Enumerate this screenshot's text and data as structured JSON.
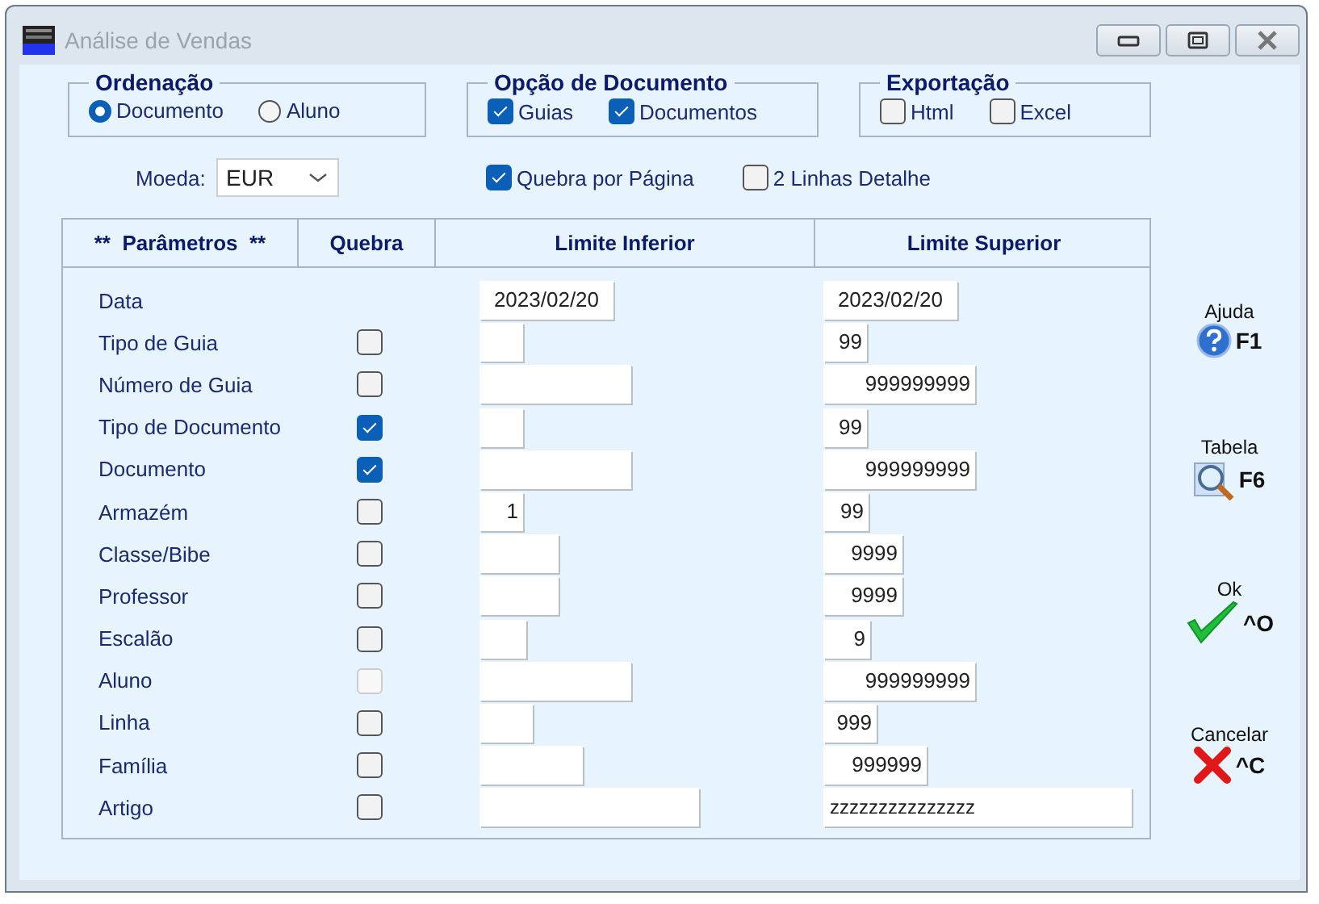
{
  "window": {
    "title": "Análise de Vendas"
  },
  "ordenacao": {
    "title": "Ordenação",
    "options": [
      {
        "label": "Documento",
        "selected": true
      },
      {
        "label": "Aluno",
        "selected": false
      }
    ]
  },
  "opcao_documento": {
    "title": "Opção de Documento",
    "options": [
      {
        "label": "Guias",
        "checked": true
      },
      {
        "label": "Documentos",
        "checked": true
      }
    ]
  },
  "exportacao": {
    "title": "Exportação",
    "options": [
      {
        "label": "Html",
        "checked": false
      },
      {
        "label": "Excel",
        "checked": false
      }
    ]
  },
  "moeda": {
    "label": "Moeda:",
    "value": "EUR"
  },
  "options": [
    {
      "label": "Quebra por Página",
      "checked": true
    },
    {
      "label": "2 Linhas Detalhe",
      "checked": false
    }
  ],
  "table": {
    "columns": [
      "**  Parâmetros  **",
      "Quebra",
      "Limite Inferior",
      "Limite Superior"
    ],
    "rows": [
      {
        "label": "Data",
        "inferior": "2023/02/20",
        "superior": "2023/02/20"
      },
      {
        "label": "Tipo de Guia",
        "quebra": {
          "checked": false,
          "disabled": false
        },
        "superior": "99"
      },
      {
        "label": "Número de Guia",
        "quebra": {
          "checked": false,
          "disabled": false
        },
        "superior": "999999999"
      },
      {
        "label": "Tipo de Documento",
        "quebra": {
          "checked": true,
          "disabled": false
        },
        "superior": "99"
      },
      {
        "label": "Documento",
        "quebra": {
          "checked": true,
          "disabled": false
        },
        "superior": "999999999"
      },
      {
        "label": "Armazém",
        "quebra": {
          "checked": false,
          "disabled": false
        },
        "inferior": "1",
        "superior": "99"
      },
      {
        "label": "Classe/Bibe",
        "quebra": {
          "checked": false,
          "disabled": false
        },
        "superior": "9999"
      },
      {
        "label": "Professor",
        "quebra": {
          "checked": false,
          "disabled": false
        },
        "superior": "9999"
      },
      {
        "label": "Escalão",
        "quebra": {
          "checked": false,
          "disabled": false
        },
        "superior": "9"
      },
      {
        "label": "Aluno",
        "quebra": {
          "checked": false,
          "disabled": true
        },
        "superior": "999999999"
      },
      {
        "label": "Linha",
        "quebra": {
          "checked": false,
          "disabled": false
        },
        "superior": "999"
      },
      {
        "label": "Família",
        "quebra": {
          "checked": false,
          "disabled": false
        },
        "superior": "999999"
      },
      {
        "label": "Artigo",
        "quebra": {
          "checked": false,
          "disabled": false
        },
        "superior": "zzzzzzzzzzzzzzz"
      }
    ]
  },
  "side_buttons": [
    {
      "kind": "help",
      "label": "Ajuda",
      "key": "F1"
    },
    {
      "kind": "table",
      "label": "Tabela",
      "key": "F6"
    },
    {
      "kind": "ok",
      "label": "Ok",
      "key": "^O"
    },
    {
      "kind": "cancel",
      "label": "Cancelar",
      "key": "^C"
    }
  ]
}
